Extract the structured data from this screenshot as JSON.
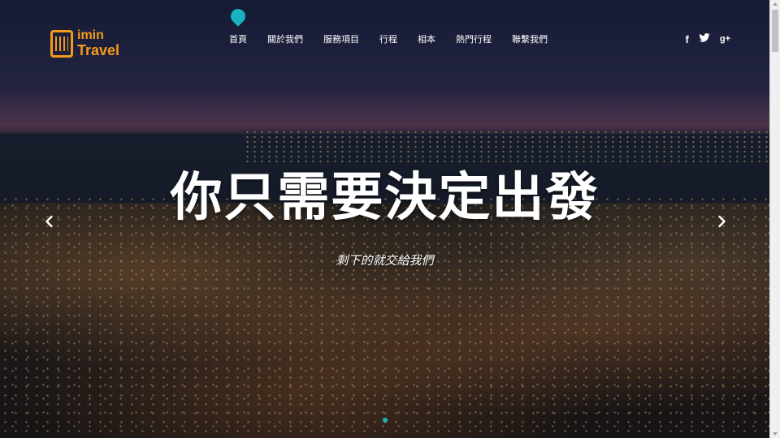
{
  "brand": {
    "line1": "imin",
    "line2": "Travel",
    "color": "#f39a1c"
  },
  "nav": {
    "items": [
      {
        "label": "首頁"
      },
      {
        "label": "關於我們"
      },
      {
        "label": "服務項目"
      },
      {
        "label": "行程"
      },
      {
        "label": "相本"
      },
      {
        "label": "熱門行程"
      },
      {
        "label": "聯繫我們"
      }
    ],
    "active_index": 0,
    "marker_icon": "map-pin-icon",
    "accent": "#18b3bf"
  },
  "social": [
    {
      "icon": "facebook-icon",
      "glyph": "f"
    },
    {
      "icon": "twitter-icon",
      "glyph": ""
    },
    {
      "icon": "google-plus-icon",
      "glyph": "g+"
    }
  ],
  "hero": {
    "headline": "你只需要決定出發",
    "subline": "剩下的就交給我們",
    "prev_icon": "chevron-left-icon",
    "next_icon": "chevron-right-icon",
    "slide_count": 1,
    "active_slide": 0
  }
}
